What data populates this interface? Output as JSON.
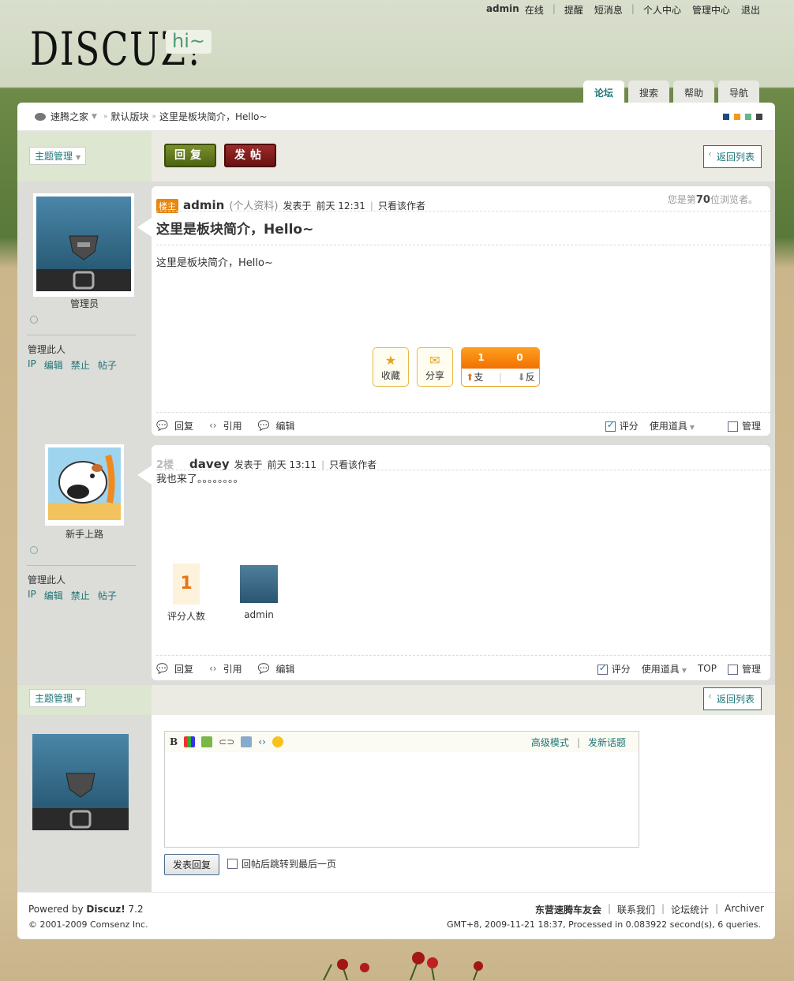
{
  "topbar": {
    "user": "admin",
    "online": "在线",
    "remind": "提醒",
    "pm": "短消息",
    "usercenter": "个人中心",
    "admincp": "管理中心",
    "logout": "退出"
  },
  "logo": {
    "text": "DISCUZ!",
    "hi": "hi~"
  },
  "nav": [
    "论坛",
    "搜索",
    "帮助",
    "导航"
  ],
  "breadcrumb": {
    "home": "速腾之家",
    "forum": "默认版块",
    "thread": "这里是板块简介，Hello~"
  },
  "theme_colors": [
    "#1f4b7a",
    "#f39a1b",
    "#6ab48a",
    "#444444"
  ],
  "toolbar": {
    "topic_manage": "主题管理",
    "reply": "回复",
    "post": "发帖",
    "back": "返回列表"
  },
  "post1": {
    "rank": "管理员",
    "manage_label": "管理此人",
    "manage_links": [
      "IP",
      "编辑",
      "禁止",
      "帖子"
    ],
    "badge": "楼主",
    "author": "admin",
    "profile": "(个人资料)",
    "posted_at": "发表于",
    "time": "前天 12:31",
    "only_author": "只看该作者",
    "views_prefix": "您是第",
    "views_count": "70",
    "views_suffix": "位浏览者。",
    "title": "这里是板块简介，Hello~",
    "body": "这里是板块简介，Hello~",
    "fav": "收藏",
    "share": "分享",
    "support_count": "1",
    "oppose_count": "0",
    "support": "支持",
    "oppose": "反对",
    "foot_reply": "回复",
    "foot_quote": "引用",
    "foot_edit": "编辑",
    "foot_rate": "评分",
    "foot_tools": "使用道具",
    "foot_manage": "管理"
  },
  "post2": {
    "rank": "新手上路",
    "manage_label": "管理此人",
    "manage_links": [
      "IP",
      "编辑",
      "禁止",
      "帖子"
    ],
    "floor": "2楼",
    "author": "davey",
    "posted_at": "发表于",
    "time": "前天 13:11",
    "only_author": "只看该作者",
    "body": "我也来了。。。。。。。。",
    "rate_count": "1",
    "rate_label": "评分人数",
    "rater": "admin",
    "foot_reply": "回复",
    "foot_quote": "引用",
    "foot_edit": "编辑",
    "foot_rate": "评分",
    "foot_tools": "使用道具",
    "foot_top": "TOP",
    "foot_manage": "管理"
  },
  "bottombar": {
    "topic_manage": "主题管理",
    "back": "返回列表"
  },
  "reply_box": {
    "advanced": "高级模式",
    "new_topic": "发新话题",
    "submit": "发表回复",
    "jump_last": "回帖后跳转到最后一页"
  },
  "footer": {
    "powered_prefix": "Powered by ",
    "powered_name": "Discuz!",
    "version": " 7.2",
    "copyright": "© 2001-2009 Comsenz Inc.",
    "site": "东营速腾车友会",
    "contact": "联系我们",
    "stats": "论坛统计",
    "archiver": "Archiver",
    "runtime": "GMT+8, 2009-11-21 18:37, Processed in 0.083922 second(s), 6 queries."
  }
}
